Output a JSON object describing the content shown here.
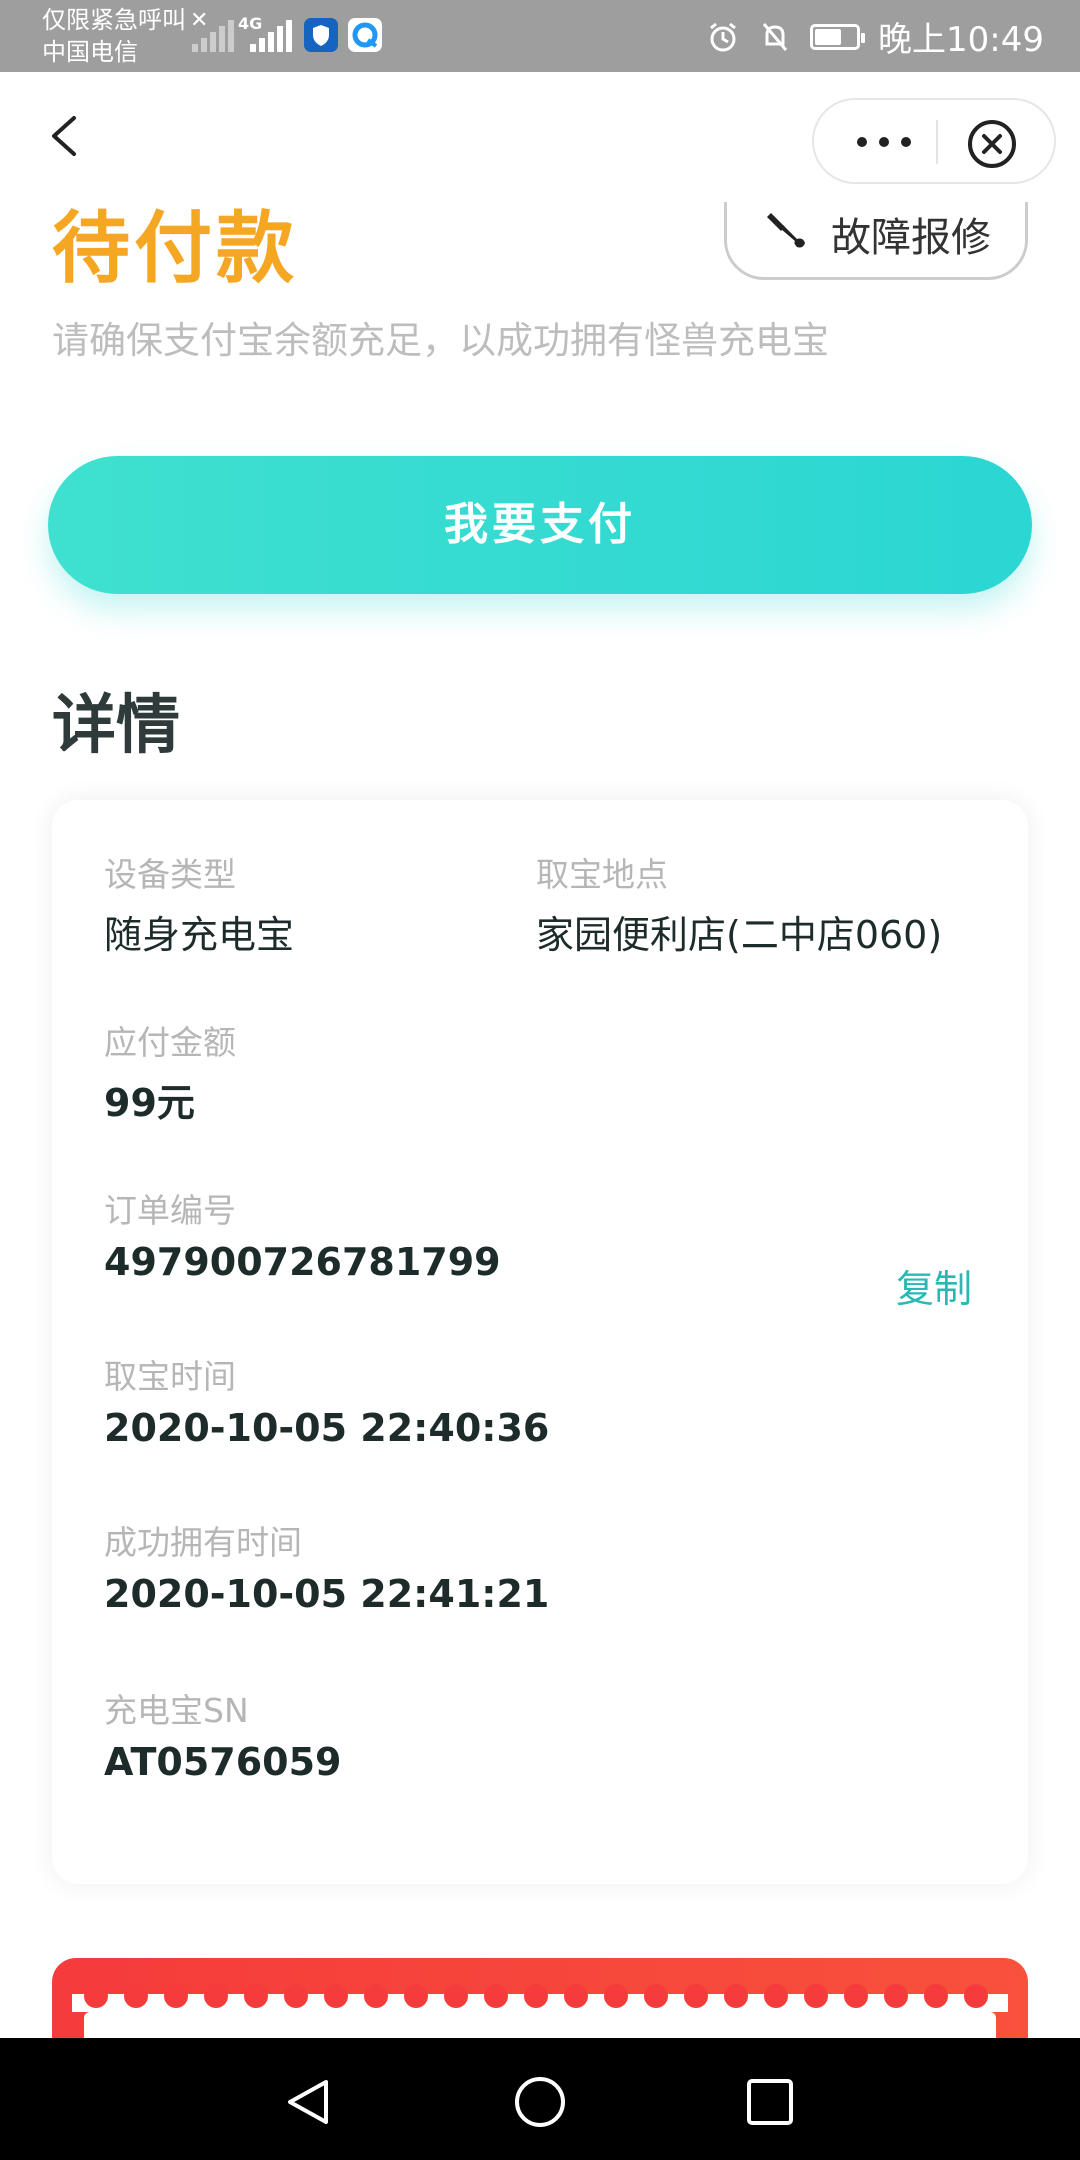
{
  "status_bar": {
    "carrier_line1": "仅限紧急呼叫",
    "carrier_line2": "中国电信",
    "network": "4G",
    "time": "晚上10:49"
  },
  "nav": {
    "more_label": "•••"
  },
  "order": {
    "status": "待付款",
    "repair_label": "故障报修",
    "hint": "请确保支付宝余额充足，以成功拥有怪兽充电宝",
    "pay_label": "我要支付"
  },
  "details": {
    "title": "详情",
    "device_type_label": "设备类型",
    "device_type": "随身充电宝",
    "pickup_location_label": "取宝地点",
    "pickup_location": "家园便利店(二中店060)",
    "amount_label": "应付金额",
    "amount": "99元",
    "order_no_label": "订单编号",
    "order_no": "497900726781799",
    "copy_label": "复制",
    "pickup_time_label": "取宝时间",
    "pickup_time": "2020-10-05 22:40:36",
    "owned_time_label": "成功拥有时间",
    "owned_time": "2020-10-05 22:41:21",
    "sn_label": "充电宝SN",
    "sn": "AT0576059"
  },
  "colors": {
    "status_orange": "#f5a623",
    "accent_teal": "#2bd6d3",
    "copy_teal": "#2bb8b5",
    "coupon_red": "#f53b3b"
  },
  "icons": {
    "back": "back-arrow-icon",
    "more": "more-dots-icon",
    "close": "close-circle-icon",
    "repair": "wrench-icon",
    "sys_back": "triangle-back-icon",
    "sys_home": "circle-home-icon",
    "sys_recent": "square-recents-icon"
  }
}
